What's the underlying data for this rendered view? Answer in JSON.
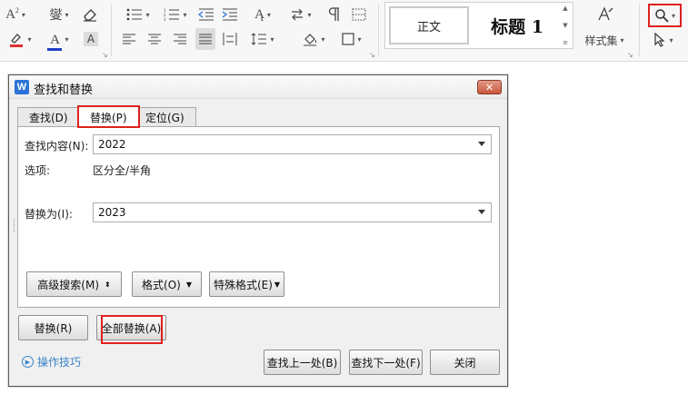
{
  "ribbon": {
    "font": {
      "superscript_label": "A",
      "pinyin_label": "燮",
      "eraser_label": "",
      "font_color_label": "A",
      "char_shading_label": "A"
    },
    "styles": {
      "normal_label": "正文",
      "heading1_label": "标题 1",
      "gallery_label": "样式集"
    }
  },
  "dialog": {
    "title": "查找和替换",
    "tabs": [
      {
        "label": "查找(D)"
      },
      {
        "label": "替换(P)"
      },
      {
        "label": "定位(G)"
      }
    ],
    "find_label": "查找内容(N):",
    "find_value": "2022",
    "options_label": "选项:",
    "options_value": "区分全/半角",
    "replace_label": "替换为(I):",
    "replace_value": "2023",
    "advanced_search_label": "高级搜索(M)",
    "format_label": "格式(O)",
    "special_format_label": "特殊格式(E)",
    "replace_button": "替换(R)",
    "replace_all_button": "全部替换(A)",
    "help_link": "操作技巧",
    "find_prev_button": "查找上一处(B)",
    "find_next_button": "查找下一处(F)",
    "close_button": "关闭"
  }
}
